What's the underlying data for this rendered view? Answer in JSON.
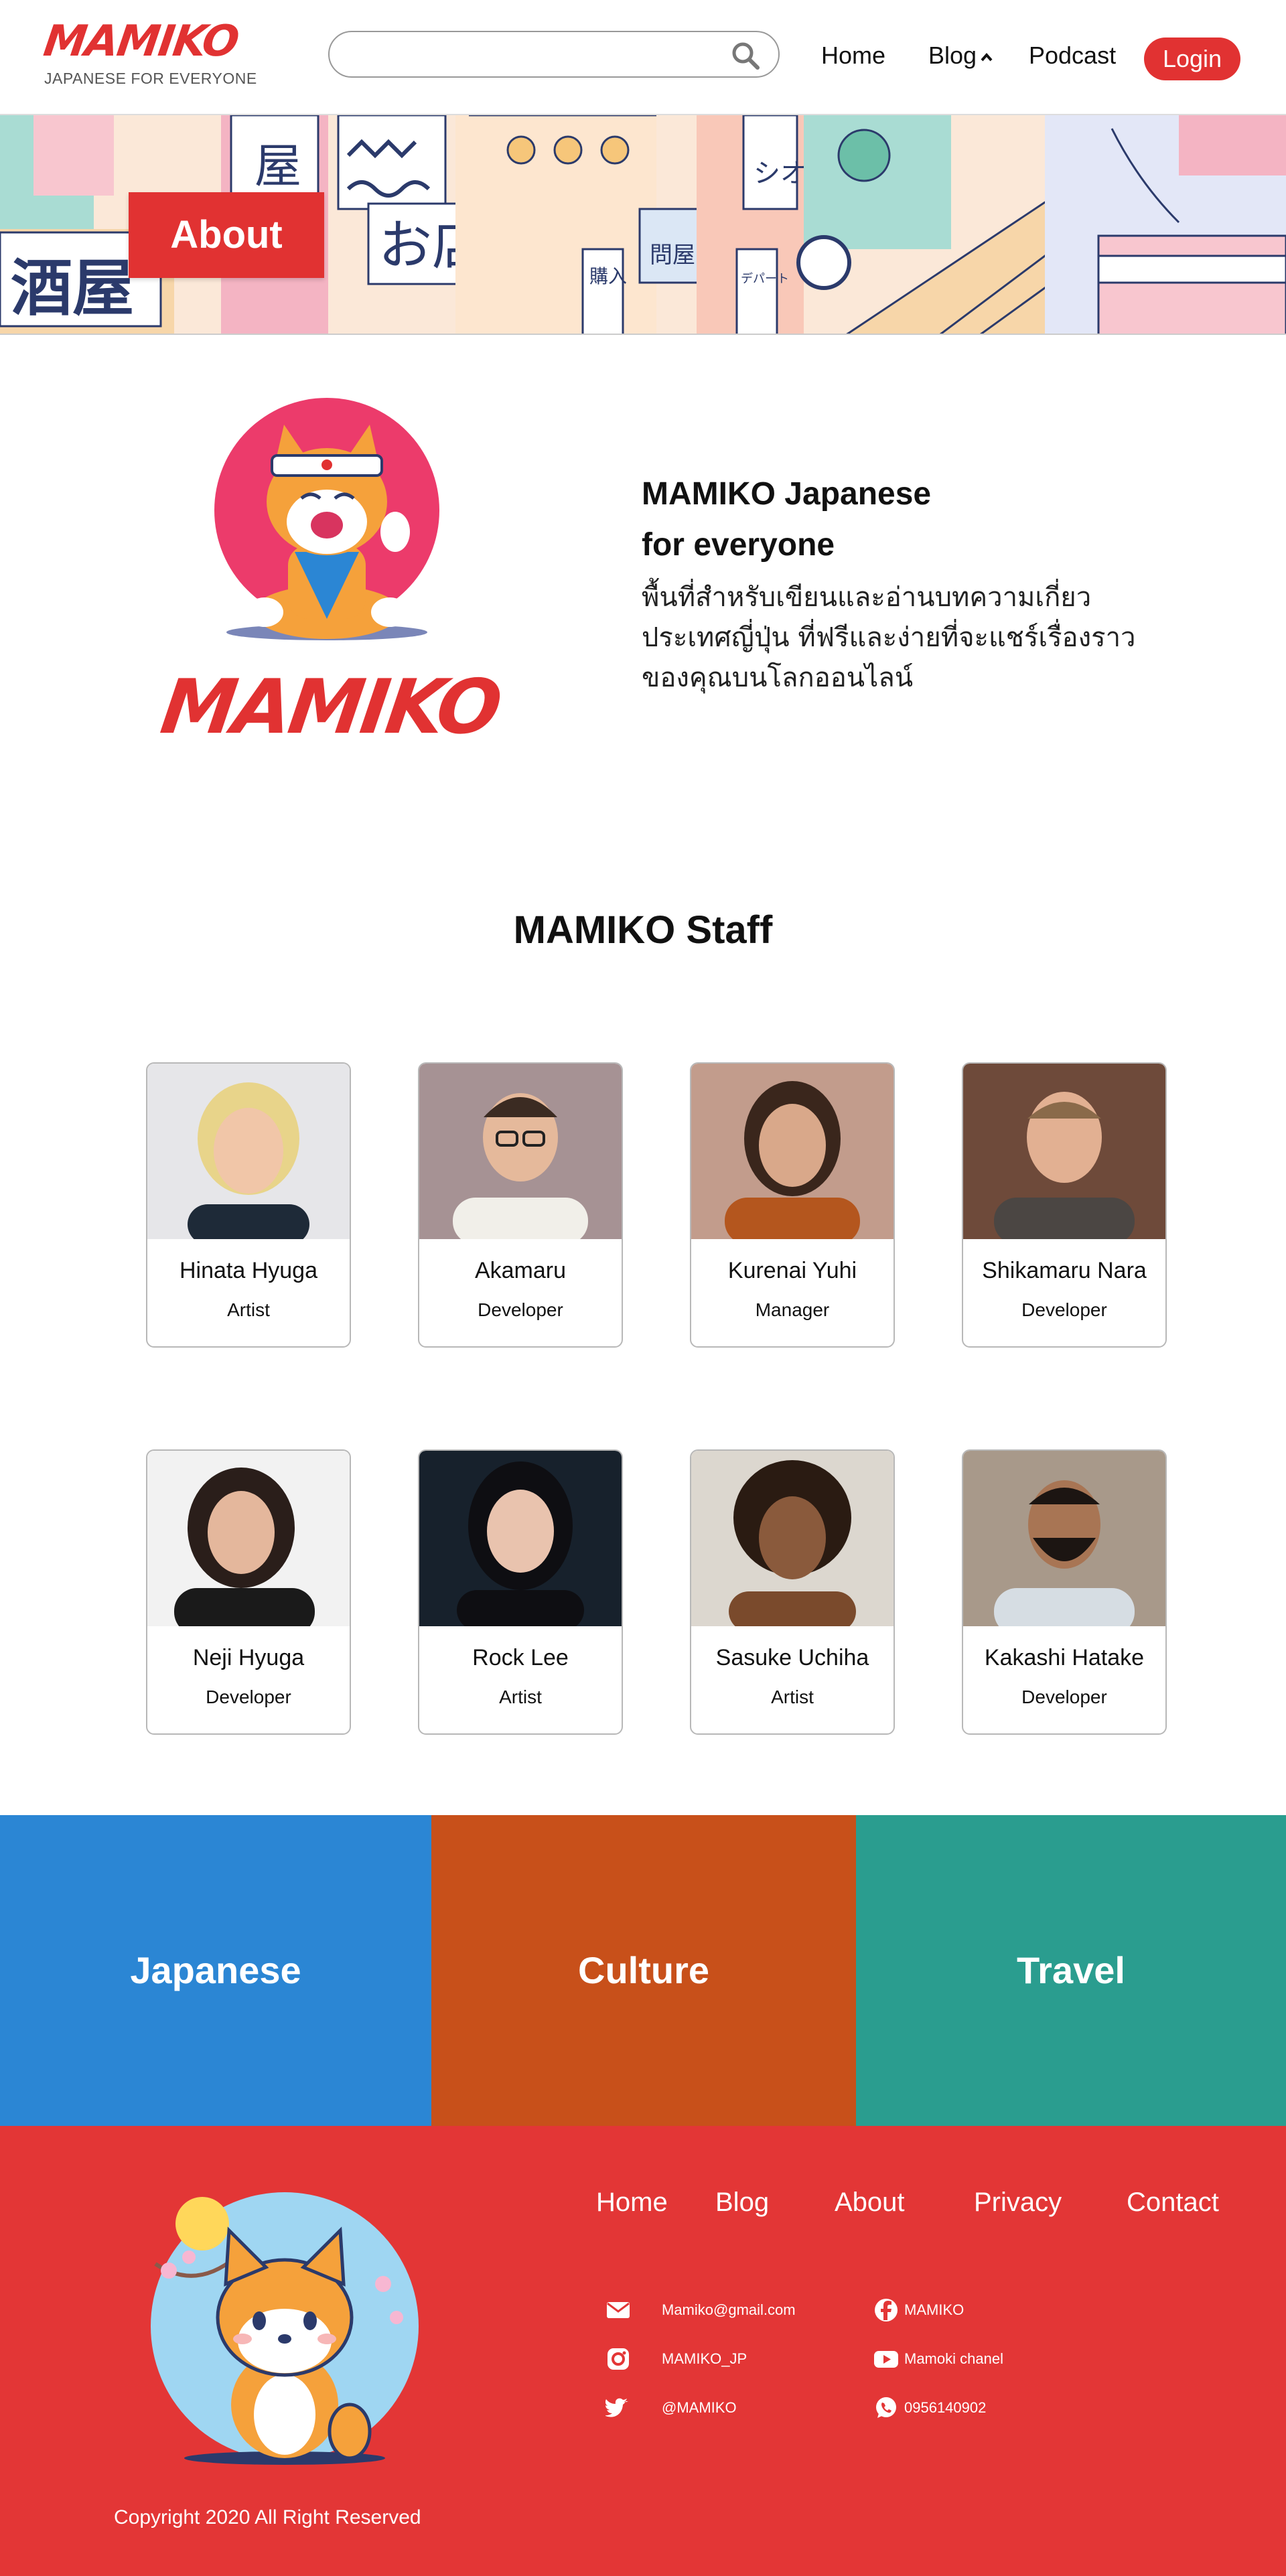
{
  "brand": {
    "logo": "MAMIKO",
    "tagline": "JAPANESE FOR EVERYONE"
  },
  "search": {
    "placeholder": "",
    "value": ""
  },
  "nav": [
    {
      "label": "Home"
    },
    {
      "label": "Blog"
    },
    {
      "label": "Podcast"
    }
  ],
  "login_label": "Login",
  "banner": {
    "tag": "About",
    "signs": [
      "酒屋",
      "お店",
      "屋",
      "購入",
      "問屋",
      "デパート",
      "シオ"
    ]
  },
  "intro": {
    "logo": "MAMIKO",
    "title_line1": "MAMIKO Japanese",
    "title_line2": "for everyone",
    "description": "พื้นที่สำหรับเขียนและอ่านบทความเกี่ยวประเทศญี่ปุ่น ที่ฟรีและง่ายที่จะแชร์เรื่องราวของคุณบนโลกออนไลน์"
  },
  "staff": {
    "heading": "MAMIKO Staff",
    "members": [
      {
        "name": "Hinata Hyuga",
        "role": "Artist"
      },
      {
        "name": "Akamaru",
        "role": "Developer"
      },
      {
        "name": "Kurenai Yuhi",
        "role": "Manager"
      },
      {
        "name": "Shikamaru Nara",
        "role": "Developer"
      },
      {
        "name": "Neji Hyuga",
        "role": "Developer"
      },
      {
        "name": "Rock Lee",
        "role": "Artist"
      },
      {
        "name": "Sasuke Uchiha",
        "role": "Artist"
      },
      {
        "name": "Kakashi Hatake",
        "role": "Developer"
      }
    ]
  },
  "categories": [
    {
      "label": "Japanese",
      "color": "#2b86d4"
    },
    {
      "label": "Culture",
      "color": "#c8501a"
    },
    {
      "label": "Travel",
      "color": "#2a9d8f"
    }
  ],
  "footer": {
    "nav": [
      {
        "label": "Home"
      },
      {
        "label": "Blog"
      },
      {
        "label": "About"
      },
      {
        "label": "Privacy"
      },
      {
        "label": "Contact"
      }
    ],
    "contacts": {
      "email": "Mamiko@gmail.com",
      "facebook": "MAMIKO",
      "instagram": "MAMIKO_JP",
      "youtube": "Mamoki chanel",
      "twitter": "@MAMIKO",
      "whatsapp": "0956140902"
    },
    "copyright": "Copyright 2020 All Right Reserved"
  },
  "colors": {
    "brand_red": "#e13232",
    "footer_red": "#e33636"
  }
}
